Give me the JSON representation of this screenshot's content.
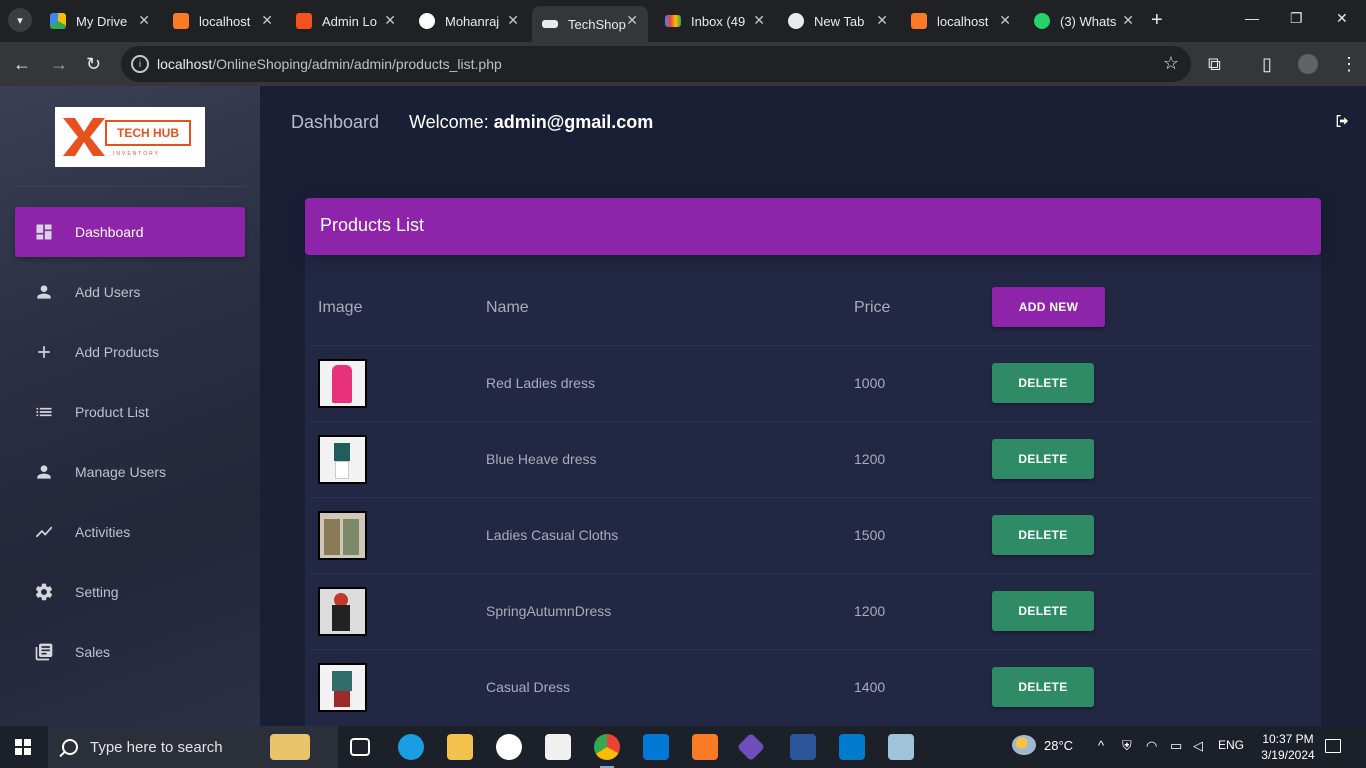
{
  "browser": {
    "tabs": [
      {
        "title": "My Drive",
        "icon": "google-drive-icon",
        "color": "#34a853"
      },
      {
        "title": "localhost",
        "icon": "xampp-icon",
        "color": "#fb7a24"
      },
      {
        "title": "Admin Lo",
        "icon": "admin-icon",
        "color": "#f4511e"
      },
      {
        "title": "Mohanraj",
        "icon": "github-icon",
        "color": "#ffffff"
      },
      {
        "title": "TechShop",
        "icon": "techshop-icon",
        "color": "#e8eaed"
      },
      {
        "title": "Inbox (49",
        "icon": "gmail-icon",
        "color": "#ea4335"
      },
      {
        "title": "New Tab",
        "icon": "chrome-icon",
        "color": "#e8eaed"
      },
      {
        "title": "localhost",
        "icon": "xampp-icon",
        "color": "#fb7a24"
      },
      {
        "title": "(3) Whats",
        "icon": "whatsapp-icon",
        "color": "#25d366"
      }
    ],
    "url_host": "localhost",
    "url_path": "/OnlineShoping/admin/admin/products_list.php"
  },
  "sidebar": {
    "logo_text": "TECH HUB",
    "logo_subtext": "INVENTORY",
    "items": [
      {
        "label": "Dashboard",
        "icon": "dashboard-icon",
        "active": true
      },
      {
        "label": "Add Users",
        "icon": "person-icon"
      },
      {
        "label": "Add Products",
        "icon": "plus-icon"
      },
      {
        "label": "Product List",
        "icon": "list-icon"
      },
      {
        "label": "Manage Users",
        "icon": "person-icon"
      },
      {
        "label": "Activities",
        "icon": "trending-icon"
      },
      {
        "label": "Setting",
        "icon": "gear-icon"
      },
      {
        "label": "Sales",
        "icon": "library-icon"
      }
    ]
  },
  "header": {
    "title": "Dashboard",
    "welcome_label": "Welcome:",
    "user_email": "admin@gmail.com"
  },
  "products_card": {
    "title": "Products List",
    "columns": [
      "Image",
      "Name",
      "Price"
    ],
    "add_button_label": "ADD NEW",
    "delete_label": "DELETE",
    "rows": [
      {
        "name": "Red Ladies dress",
        "price": "1000",
        "thumb_color": "#e8317a"
      },
      {
        "name": "Blue Heave dress",
        "price": "1200",
        "thumb_color": "#1f5e5a"
      },
      {
        "name": "Ladies Casual Cloths",
        "price": "1500",
        "thumb_color": "#8a7a55"
      },
      {
        "name": "SpringAutumnDress",
        "price": "1200",
        "thumb_color": "#222222"
      },
      {
        "name": "Casual Dress",
        "price": "1400",
        "thumb_color": "#2f6e6a"
      }
    ]
  },
  "theme": {
    "accent": "#8e24aa",
    "delete_button": "#2e8b66",
    "page_background": "#1b1f36"
  },
  "taskbar": {
    "search_placeholder": "Type here to search",
    "weather": "28°C",
    "language": "ENG",
    "time": "10:37 PM",
    "date": "3/19/2024"
  }
}
